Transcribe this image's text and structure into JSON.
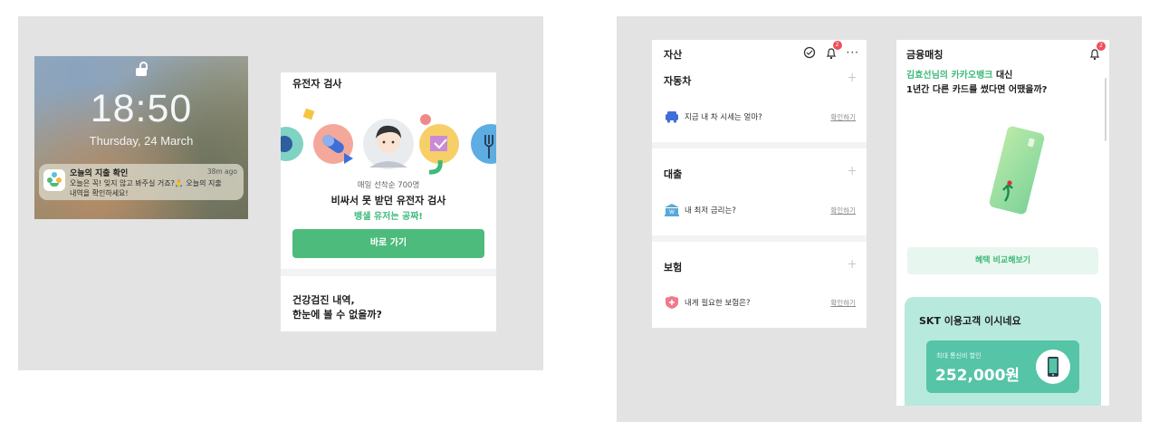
{
  "lockscreen": {
    "time": "18:50",
    "date": "Thursday, 24 March",
    "notification": {
      "title": "오늘의 지출 확인",
      "ago": "38m ago",
      "body_line1": "오늘은 꼭! 잊지 않고 봐주실 거죠?🙏 오늘의 지출",
      "body_line2": "내역을 확인하세요!"
    }
  },
  "gene_card": {
    "title": "유전자 검사",
    "sub": "매일 선착순 700명",
    "headline": "비싸서 못 받던 유전자 검사",
    "highlight": "뱅샐 유저는 공짜!",
    "button": "바로 가기",
    "next_line1": "건강검진 내역,",
    "next_line2": "한눈에 볼 수 없을까?"
  },
  "asset_card": {
    "title": "자산",
    "badge": "2",
    "sections": [
      {
        "title": "자동차",
        "row": "지금 내 차 시세는 얼마?",
        "link": "확인하기",
        "icon": "car-icon"
      },
      {
        "title": "대출",
        "row": "내 최저 금리는?",
        "link": "확인하기",
        "icon": "bank-icon"
      },
      {
        "title": "보험",
        "row": "내게 필요한 보험은?",
        "link": "확인하기",
        "icon": "shield-plus-icon"
      }
    ]
  },
  "finance_card": {
    "title": "금융매칭",
    "badge": "2",
    "line1_highlight": "김효선님의 카카오뱅크",
    "line1_rest": " 대신",
    "line2": "1년간 다른 카드를 썼다면 어땠을까?",
    "compare_button": "혜택 비교해보기",
    "skt_title": "SKT 이용고객 이시네요",
    "discount_label": "최대 통신비 할인",
    "discount_amount": "252,000원"
  },
  "colors": {
    "accent_green": "#4dbb7c",
    "badge_red": "#f0505a",
    "mint": "#b7e9dd"
  }
}
